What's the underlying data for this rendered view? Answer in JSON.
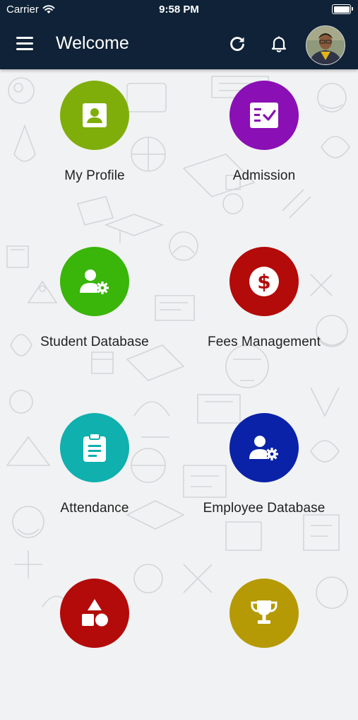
{
  "status_bar": {
    "carrier": "Carrier",
    "time": "9:58 PM"
  },
  "header": {
    "title": "Welcome",
    "icons": [
      "menu-icon",
      "refresh-icon",
      "bell-icon"
    ],
    "background": "#0f2237"
  },
  "menu": {
    "items": [
      {
        "label": "My Profile",
        "icon": "profile-card-icon",
        "color": "#7fae0a"
      },
      {
        "label": "Admission",
        "icon": "form-check-icon",
        "color": "#8a0fb4"
      },
      {
        "label": "Student Database",
        "icon": "user-gear-icon",
        "color": "#3ab50a"
      },
      {
        "label": "Fees Management",
        "icon": "dollar-icon",
        "color": "#b30a0a"
      },
      {
        "label": "Attendance",
        "icon": "clipboard-icon",
        "color": "#0fb0ae"
      },
      {
        "label": "Employee Database",
        "icon": "user-gear-icon",
        "color": "#0a22a8"
      },
      {
        "label": "",
        "icon": "shapes-icon",
        "color": "#b30a0a"
      },
      {
        "label": "",
        "icon": "trophy-icon",
        "color": "#b59a05"
      }
    ]
  }
}
